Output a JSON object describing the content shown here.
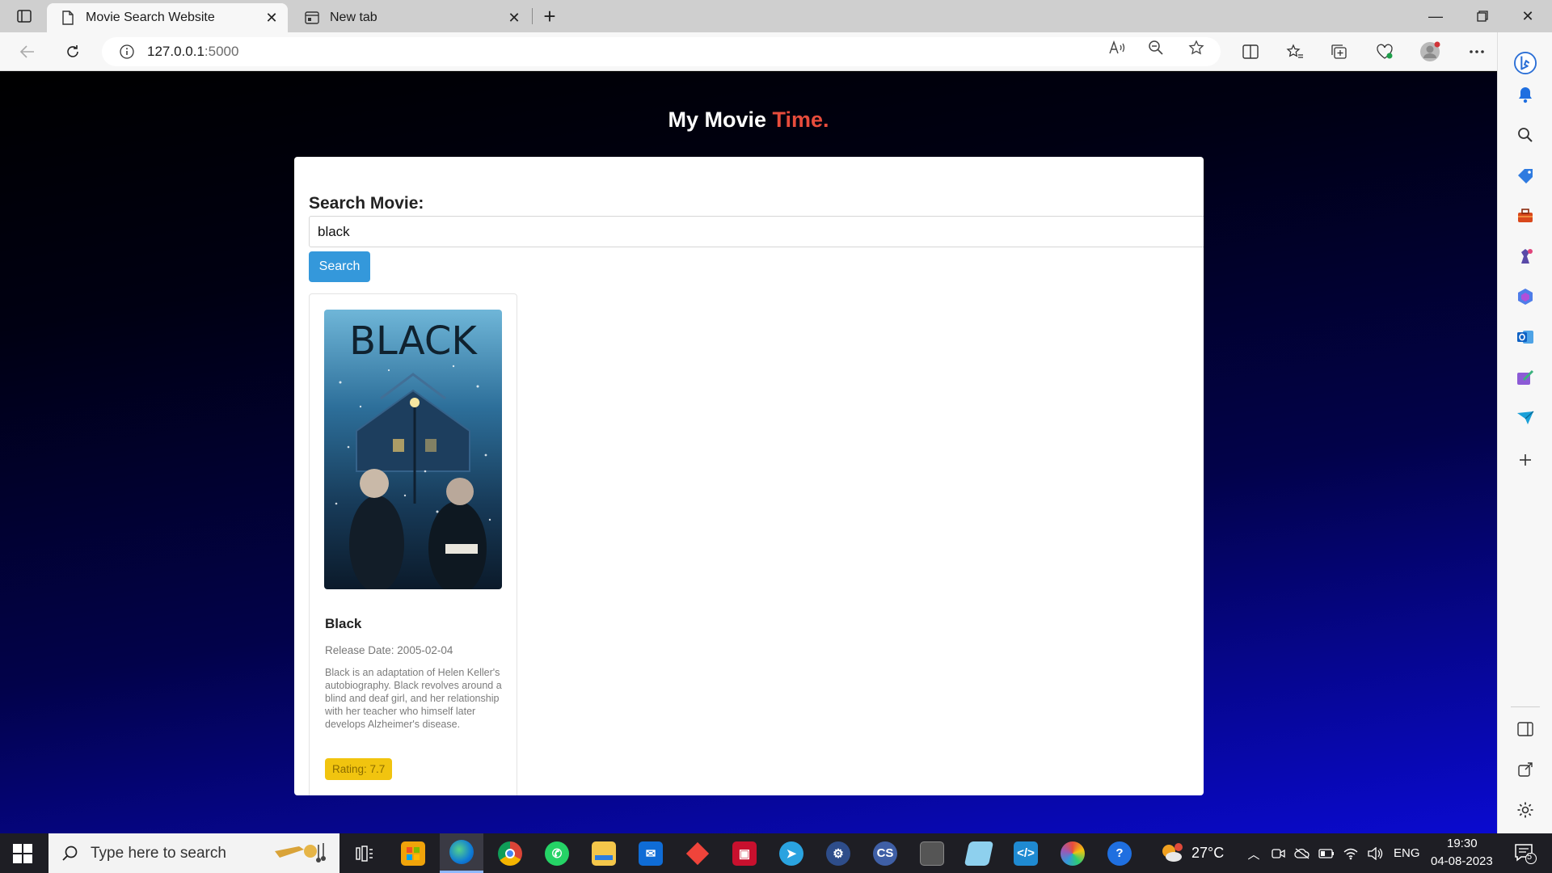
{
  "browser": {
    "tabs": [
      {
        "title": "Movie Search Website",
        "active": true,
        "icon": "document-icon"
      },
      {
        "title": "New tab",
        "active": false,
        "icon": "newtab-icon"
      }
    ],
    "url_host": "127.0.0.1",
    "url_port": ":5000"
  },
  "site": {
    "title_main": "My Movie ",
    "title_accent": "Time."
  },
  "search": {
    "label": "Search Movie:",
    "value": "black",
    "button_label": "Search"
  },
  "results": [
    {
      "title": "Black",
      "poster_text": "BLACK",
      "release": "Release Date: 2005-02-04",
      "overview": "Black is an adaptation of Helen Keller's autobiography. Black revolves around a blind and deaf girl, and her relationship with her teacher who himself later develops Alzheimer's disease.",
      "rating": "Rating: 7.7"
    }
  ],
  "taskbar": {
    "search_placeholder": "Type here to search",
    "weather": "27°C",
    "language": "ENG",
    "time": "19:30",
    "date": "04-08-2023",
    "notifications": "5"
  },
  "colors": {
    "accent": "#e74c3c",
    "button": "#3498db",
    "rating_badge": "#f1c40f"
  }
}
